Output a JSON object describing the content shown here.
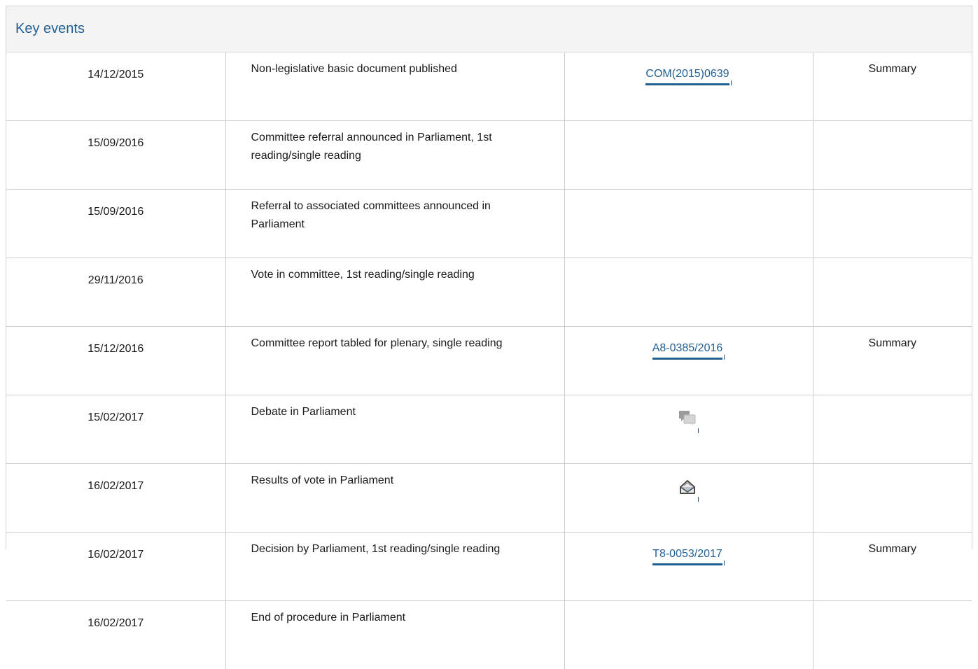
{
  "panel": {
    "title": "Key events"
  },
  "rows": [
    {
      "date": "14/12/2015",
      "event": "Non-legislative basic document published",
      "doc": "COM(2015)0639",
      "doc_type": "link",
      "summary": "Summary"
    },
    {
      "date": "15/09/2016",
      "event": "Committee referral announced in Parliament, 1st reading/single reading",
      "doc": "",
      "doc_type": "none",
      "summary": ""
    },
    {
      "date": "15/09/2016",
      "event": "Referral to associated committees announced in Parliament",
      "doc": "",
      "doc_type": "none",
      "summary": ""
    },
    {
      "date": "29/11/2016",
      "event": "Vote in committee, 1st reading/single reading",
      "doc": "",
      "doc_type": "none",
      "summary": ""
    },
    {
      "date": "15/12/2016",
      "event": "Committee report tabled for plenary, single reading",
      "doc": "A8-0385/2016",
      "doc_type": "link",
      "summary": "Summary"
    },
    {
      "date": "15/02/2017",
      "event": "Debate in Parliament",
      "doc": "debate-icon",
      "doc_type": "icon",
      "summary": ""
    },
    {
      "date": "16/02/2017",
      "event": "Results of vote in Parliament",
      "doc": "vote-results-icon",
      "doc_type": "icon",
      "summary": ""
    },
    {
      "date": "16/02/2017",
      "event": "Decision by Parliament, 1st reading/single reading",
      "doc": "T8-0053/2017",
      "doc_type": "link",
      "summary": "Summary"
    },
    {
      "date": "16/02/2017",
      "event": "End of procedure in Parliament",
      "doc": "",
      "doc_type": "none",
      "summary": ""
    }
  ],
  "colors": {
    "link": "#1f5f94",
    "header_bg": "#f4f4f4",
    "border": "#cccccc"
  }
}
